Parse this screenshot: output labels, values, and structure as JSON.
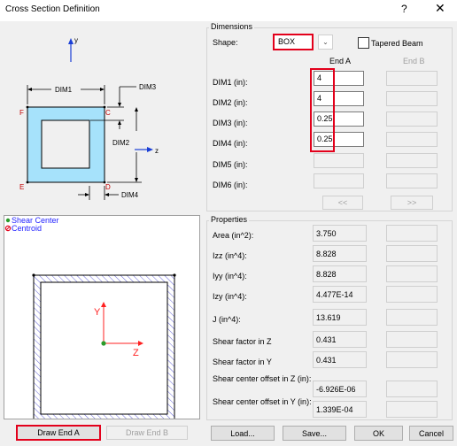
{
  "window": {
    "title": "Cross Section Definition",
    "help": "?",
    "close": "✕"
  },
  "sketch": {
    "axis_y": "y",
    "axis_z": "z",
    "dim1": "DIM1",
    "dim2": "DIM2",
    "dim3": "DIM3",
    "dim4": "DIM4",
    "pt_c": "C",
    "pt_d": "D",
    "pt_e": "E",
    "pt_f": "F"
  },
  "preview": {
    "legend_shear": "Shear Center",
    "legend_centroid": "Centroid",
    "axis_y": "Y",
    "axis_z": "Z"
  },
  "dimensions": {
    "group_label": "Dimensions",
    "shape_label": "Shape:",
    "shape_value": "BOX",
    "tapered_label": "Tapered Beam",
    "tapered_checked": false,
    "end_a_header": "End A",
    "end_b_header": "End B",
    "rows": [
      {
        "label": "DIM1 (in):",
        "end_a": "4",
        "enabled": true
      },
      {
        "label": "DIM2 (in):",
        "end_a": "4",
        "enabled": true
      },
      {
        "label": "DIM3 (in):",
        "end_a": "0.25",
        "enabled": true
      },
      {
        "label": "DIM4 (in):",
        "end_a": "0.25",
        "enabled": true
      },
      {
        "label": "DIM5 (in):",
        "end_a": "",
        "enabled": false
      },
      {
        "label": "DIM6 (in):",
        "end_a": "",
        "enabled": false
      }
    ],
    "copy_left": "<<",
    "copy_right": ">>"
  },
  "properties": {
    "group_label": "Properties",
    "rows": [
      {
        "label": "Area (in^2):",
        "value": "3.750"
      },
      {
        "label": "Izz (in^4):",
        "value": "8.828"
      },
      {
        "label": "Iyy (in^4):",
        "value": "8.828"
      },
      {
        "label": "Izy (in^4):",
        "value": "4.477E-14"
      },
      {
        "label": "J (in^4):",
        "value": "13.619"
      },
      {
        "label": "Shear factor in Z",
        "value": "0.431"
      },
      {
        "label": "Shear factor in Y",
        "value": "0.431"
      },
      {
        "label": "Shear center offset in Z (in):",
        "value": "-6.926E-06"
      },
      {
        "label": "Shear center offset in Y (in):",
        "value": "1.339E-04"
      }
    ]
  },
  "buttons": {
    "draw_end_a": "Draw End A",
    "draw_end_b": "Draw End B",
    "load": "Load...",
    "save": "Save...",
    "ok": "OK",
    "cancel": "Cancel"
  },
  "colors": {
    "section_fill": "#a6e2fb",
    "highlight": "#e3001b",
    "axis_red": "#ff2020",
    "legend_blue": "#2424ff",
    "centroid_green": "#2a9c2a"
  }
}
